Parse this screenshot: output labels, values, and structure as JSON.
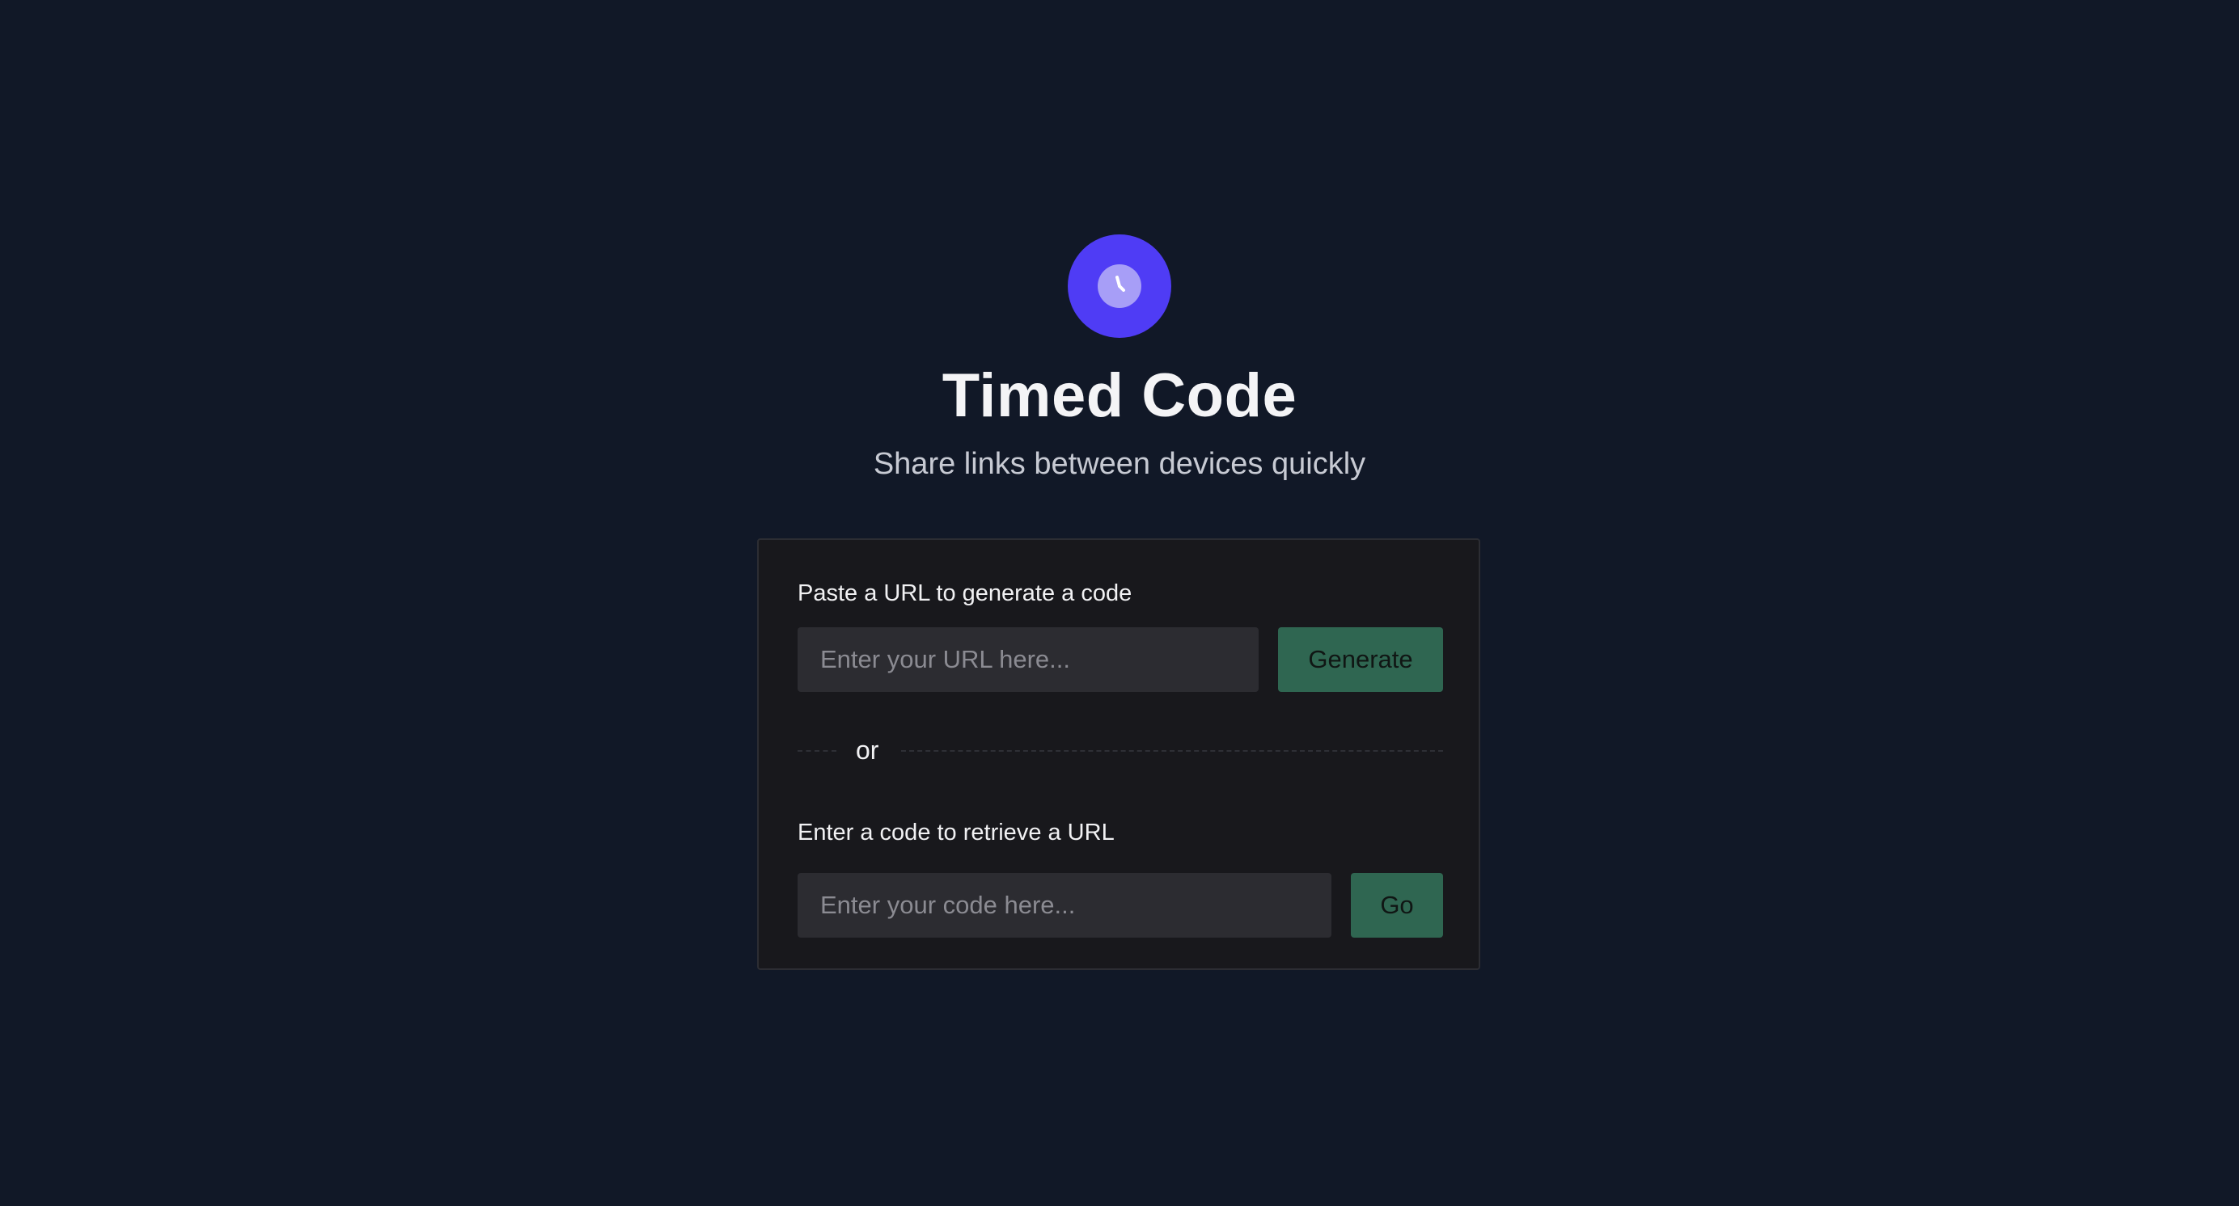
{
  "app": {
    "logo_icon": "clock-icon",
    "accent_color": "#4f3cf5",
    "title": "Timed Code",
    "subtitle": "Share links between devices quickly"
  },
  "generate_section": {
    "label": "Paste a URL to generate a code",
    "input_placeholder": "Enter your URL here...",
    "input_value": "",
    "button_label": "Generate",
    "button_color": "#2f6651"
  },
  "divider": {
    "text": "or"
  },
  "retrieve_section": {
    "label": "Enter a code to retrieve a URL",
    "input_placeholder": "Enter your code here...",
    "input_value": "",
    "button_label": "Go",
    "button_color": "#2f6651"
  }
}
